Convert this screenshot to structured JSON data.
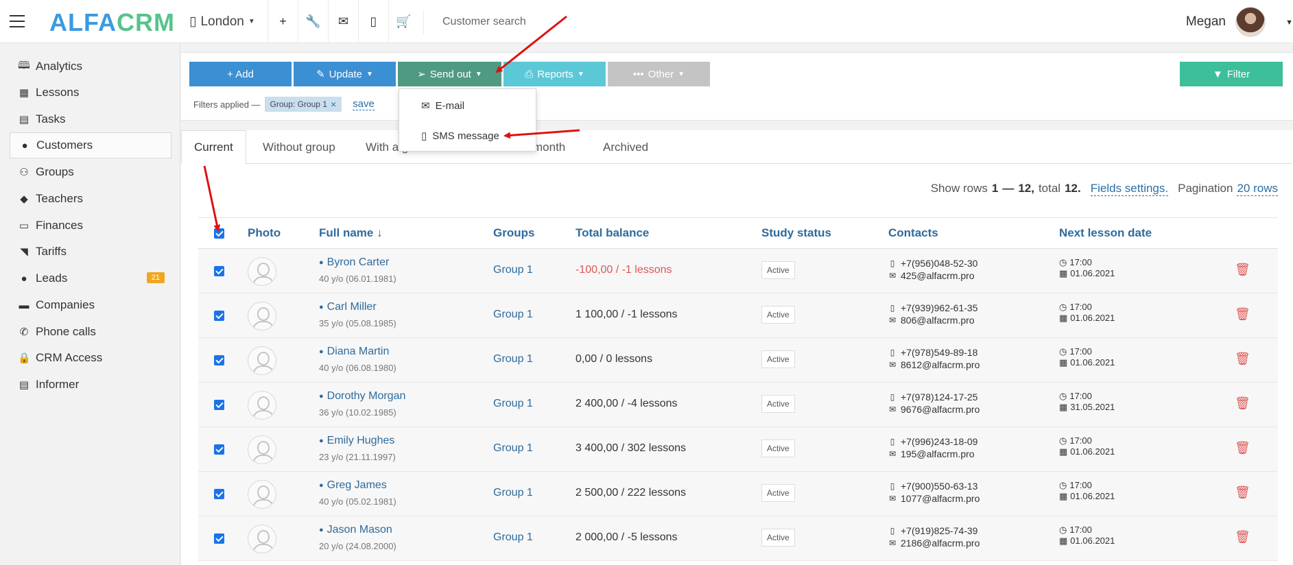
{
  "header": {
    "logo_part1": "ALFA",
    "logo_part2": "CRM",
    "branch": "London",
    "search_placeholder": "Customer search",
    "user_name": "Megan",
    "icons": [
      "add-icon",
      "wrench-icon",
      "envelope-icon",
      "mobile-icon",
      "cart-icon"
    ]
  },
  "sidebar": {
    "items": [
      {
        "label": "Analytics",
        "icon": "book-icon"
      },
      {
        "label": "Lessons",
        "icon": "calendar-icon"
      },
      {
        "label": "Tasks",
        "icon": "clipboard-icon"
      },
      {
        "label": "Customers",
        "icon": "user-icon",
        "active": true
      },
      {
        "label": "Groups",
        "icon": "users-icon"
      },
      {
        "label": "Teachers",
        "icon": "graduation-cap-icon"
      },
      {
        "label": "Finances",
        "icon": "money-icon"
      },
      {
        "label": "Tariffs",
        "icon": "tag-icon"
      },
      {
        "label": "Leads",
        "icon": "user-plus-icon",
        "badge": "21"
      },
      {
        "label": "Companies",
        "icon": "briefcase-icon"
      },
      {
        "label": "Phone calls",
        "icon": "phone-icon"
      },
      {
        "label": "CRM Access",
        "icon": "lock-icon"
      },
      {
        "label": "Informer",
        "icon": "list-icon"
      }
    ],
    "badge_color": "#f1a621"
  },
  "toolbar": {
    "add": "+ Add",
    "update": "Update",
    "send_out": "Send out",
    "reports": "Reports",
    "other": "Other",
    "filter": "Filter",
    "colors": {
      "add": "#3b8fd3",
      "update": "#3b8fd3",
      "send_out": "#4f9a82",
      "reports": "#5bc8d8",
      "other": "#c4c4c4",
      "filter": "#3cbf9a"
    }
  },
  "filters": {
    "label": "Filters applied —",
    "chip": "Group: Group 1",
    "save": "save"
  },
  "send_out_menu": {
    "items": [
      {
        "label": "E-mail",
        "icon": "envelope-icon"
      },
      {
        "label": "SMS message",
        "icon": "mobile-icon"
      }
    ]
  },
  "tabs": [
    {
      "label": "Current",
      "active": true
    },
    {
      "label": "Without group"
    },
    {
      "label": "With a g"
    },
    {
      "label": "month"
    },
    {
      "label": "Archived"
    }
  ],
  "pagination": {
    "prefix": "Show rows",
    "range_start": "1",
    "dash": "—",
    "range_end": "12,",
    "total_label": "total",
    "total": "12.",
    "fields_settings": "Fields settings.",
    "pagination_label": "Pagination",
    "page_size": "20 rows"
  },
  "table": {
    "columns": [
      "Photo",
      "Full name ↓",
      "Groups",
      "Total balance",
      "Study status",
      "Contacts",
      "Next lesson date"
    ],
    "rows": [
      {
        "name": "Byron Carter",
        "age": "40 y/o (06.01.1981)",
        "group": "Group 1",
        "balance": "-100,00 / -1 lessons",
        "negative": true,
        "status": "Active",
        "phone": "+7(956)048-52-30",
        "email": "425@alfacrm.pro",
        "time": "17:00",
        "date": "01.06.2021"
      },
      {
        "name": "Carl Miller",
        "age": "35 y/o (05.08.1985)",
        "group": "Group 1",
        "balance": "1 100,00 / -1 lessons",
        "negative": false,
        "status": "Active",
        "phone": "+7(939)962-61-35",
        "email": "806@alfacrm.pro",
        "time": "17:00",
        "date": "01.06.2021"
      },
      {
        "name": "Diana Martin",
        "age": "40 y/o (06.08.1980)",
        "group": "Group 1",
        "balance": "0,00 / 0 lessons",
        "negative": false,
        "status": "Active",
        "phone": "+7(978)549-89-18",
        "email": "8612@alfacrm.pro",
        "time": "17:00",
        "date": "01.06.2021"
      },
      {
        "name": "Dorothy Morgan",
        "age": "36 y/o (10.02.1985)",
        "group": "Group 1",
        "balance": "2 400,00 / -4 lessons",
        "negative": false,
        "status": "Active",
        "phone": "+7(978)124-17-25",
        "email": "9676@alfacrm.pro",
        "time": "17:00",
        "date": "31.05.2021"
      },
      {
        "name": "Emily Hughes",
        "age": "23 y/o (21.11.1997)",
        "group": "Group 1",
        "balance": "3 400,00 / 302 lessons",
        "negative": false,
        "status": "Active",
        "phone": "+7(996)243-18-09",
        "email": "195@alfacrm.pro",
        "time": "17:00",
        "date": "01.06.2021"
      },
      {
        "name": "Greg James",
        "age": "40 y/o (05.02.1981)",
        "group": "Group 1",
        "balance": "2 500,00 / 222 lessons",
        "negative": false,
        "status": "Active",
        "phone": "+7(900)550-63-13",
        "email": "1077@alfacrm.pro",
        "time": "17:00",
        "date": "01.06.2021"
      },
      {
        "name": "Jason Mason",
        "age": "20 y/o (24.08.2000)",
        "group": "Group 1",
        "balance": "2 000,00 / -5 lessons",
        "negative": false,
        "status": "Active",
        "phone": "+7(919)825-74-39",
        "email": "2186@alfacrm.pro",
        "time": "17:00",
        "date": "01.06.2021"
      }
    ]
  },
  "annotation_color": "#e01010"
}
